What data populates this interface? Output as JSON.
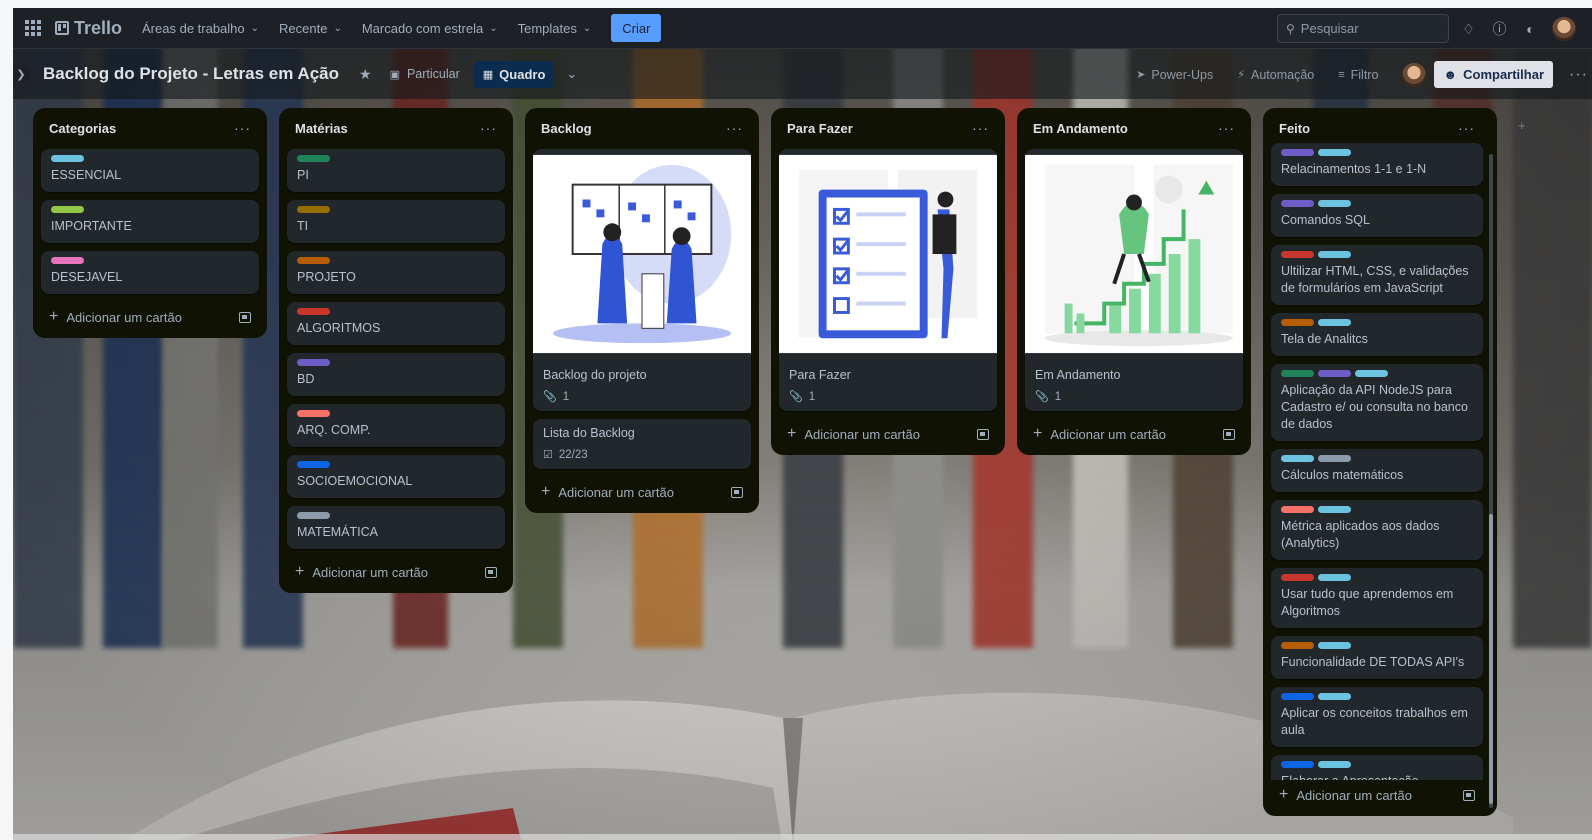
{
  "topbar": {
    "app_name": "Trello",
    "nav": [
      "Áreas de trabalho",
      "Recente",
      "Marcado com estrela",
      "Templates"
    ],
    "create_label": "Criar",
    "search_placeholder": "Pesquisar"
  },
  "board": {
    "title": "Backlog do Projeto - Letras em Ação",
    "visibility": "Particular",
    "view": "Quadro",
    "powerups": "Power-Ups",
    "automation": "Automação",
    "filter": "Filtro",
    "share": "Compartilhar"
  },
  "add_card_label": "Adicionar um cartão",
  "colors": {
    "accent": "#579dff",
    "list_bg": "#101204",
    "card_bg": "#22272b"
  },
  "lists": [
    {
      "title": "Categorias",
      "cards": [
        {
          "title": "ESSENCIAL",
          "labels": [
            "#6cc3e0"
          ]
        },
        {
          "title": "IMPORTANTE",
          "labels": [
            "#94c748"
          ]
        },
        {
          "title": "DESEJAVEL",
          "labels": [
            "#e774bb"
          ]
        }
      ]
    },
    {
      "title": "Matérias",
      "cards": [
        {
          "title": "PI",
          "labels": [
            "#1f845a"
          ]
        },
        {
          "title": "TI",
          "labels": [
            "#946f00"
          ]
        },
        {
          "title": "PROJETO",
          "labels": [
            "#b65c02"
          ]
        },
        {
          "title": "ALGORITMOS",
          "labels": [
            "#c9372c"
          ]
        },
        {
          "title": "BD",
          "labels": [
            "#6e5dc6"
          ]
        },
        {
          "title": "ARQ. COMP.",
          "labels": [
            "#f87168"
          ]
        },
        {
          "title": "SOCIOEMOCIONAL",
          "labels": [
            "#0c66e4"
          ]
        },
        {
          "title": "MATEMÁTICA",
          "labels": [
            "#8c9bab"
          ]
        }
      ]
    },
    {
      "title": "Backlog",
      "cards": [
        {
          "title": "Backlog do projeto",
          "cover": "board",
          "attachments": "1",
          "labels": []
        },
        {
          "title": "Lista do Backlog",
          "checklist": "22/23",
          "labels": []
        }
      ]
    },
    {
      "title": "Para Fazer",
      "cards": [
        {
          "title": "Para Fazer",
          "cover": "checklist",
          "attachments": "1",
          "labels": []
        }
      ]
    },
    {
      "title": "Em Andamento",
      "cards": [
        {
          "title": "Em Andamento",
          "cover": "growth",
          "attachments": "1",
          "labels": []
        }
      ]
    },
    {
      "title": "Feito",
      "cards": [
        {
          "title": "Relacinamentos 1-1 e 1-N",
          "labels": [
            "#6e5dc6",
            "#6cc3e0"
          ]
        },
        {
          "title": "Comandos SQL",
          "labels": [
            "#6e5dc6",
            "#6cc3e0"
          ]
        },
        {
          "title": "Ultilizar HTML, CSS, e validações de formulários em JavaScript",
          "labels": [
            "#c9372c",
            "#6cc3e0"
          ]
        },
        {
          "title": "Tela de Analitcs",
          "labels": [
            "#b65c02",
            "#6cc3e0"
          ]
        },
        {
          "title": "Aplicação da API NodeJS para Cadastro e/ ou consulta no banco de dados",
          "labels": [
            "#1f845a",
            "#6e5dc6",
            "#6cc3e0"
          ]
        },
        {
          "title": "Cálculos matemáticos",
          "labels": [
            "#6cc3e0",
            "#8c9bab"
          ]
        },
        {
          "title": "Métrica aplicados aos dados (Analytics)",
          "labels": [
            "#f87168",
            "#6cc3e0"
          ]
        },
        {
          "title": "Usar tudo que aprendemos em Algoritmos",
          "labels": [
            "#c9372c",
            "#6cc3e0"
          ]
        },
        {
          "title": "Funcionalidade DE TODAS API's",
          "labels": [
            "#b65c02",
            "#6cc3e0"
          ]
        },
        {
          "title": "Aplicar os conceitos trabalhos em aula",
          "labels": [
            "#0c66e4",
            "#6cc3e0"
          ]
        },
        {
          "title": "Elaborar a Apresentação",
          "labels": [
            "#0c66e4",
            "#6cc3e0"
          ]
        }
      ]
    }
  ]
}
